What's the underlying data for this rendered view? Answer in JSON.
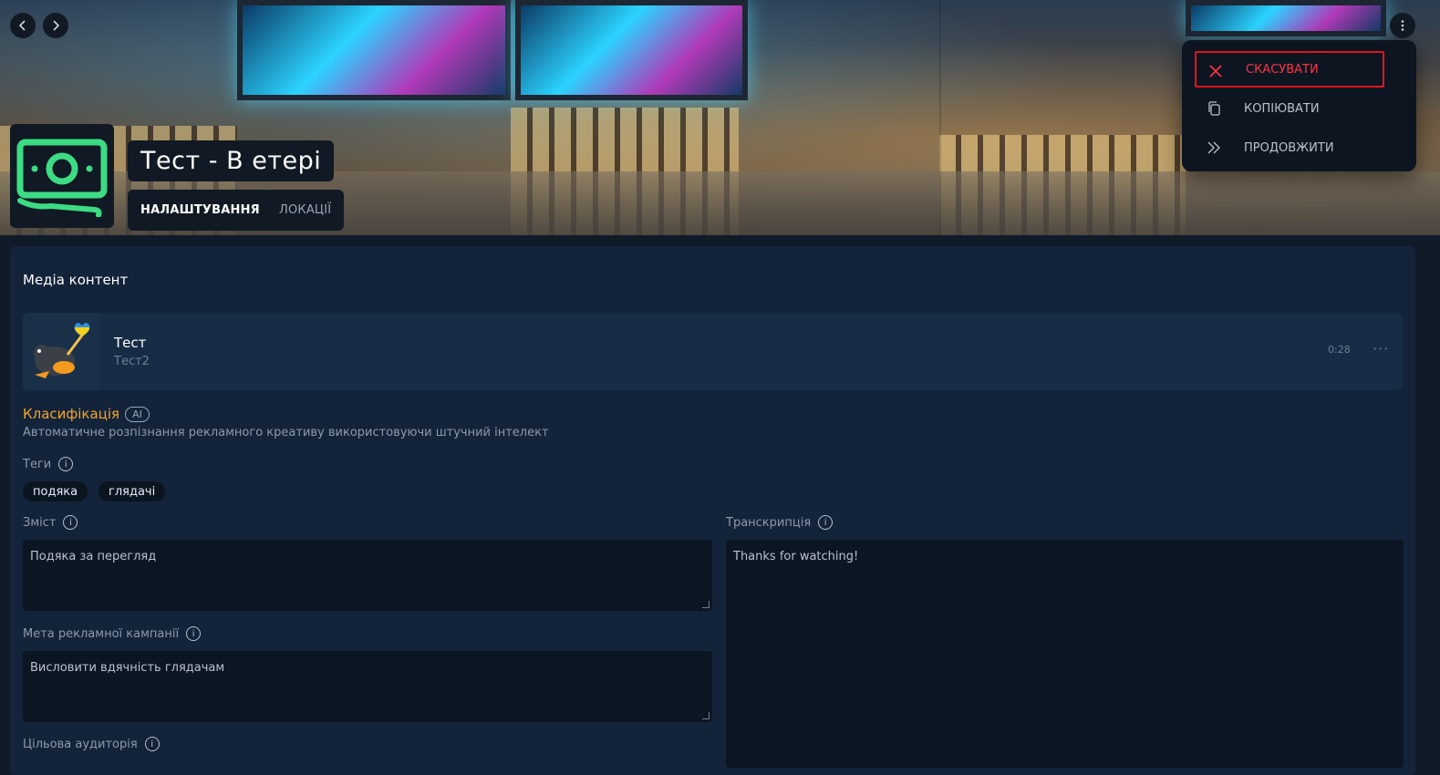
{
  "header": {
    "title": "Тест - В етері",
    "tabs": [
      {
        "label": "НАЛАШТУВАННЯ",
        "active": true
      },
      {
        "label": "ЛОКАЦІЇ",
        "active": false
      }
    ],
    "nav": {
      "back_icon": "chevron-left-icon",
      "forward_icon": "chevron-right-icon"
    },
    "logo_icon": "money-bill-icon",
    "more_icon": "vertical-dots-icon"
  },
  "menu": {
    "items": [
      {
        "label": "СКАСУВАТИ",
        "icon": "close-icon",
        "color": "#ff3347"
      },
      {
        "label": "КОПІЮВАТИ",
        "icon": "copy-icon"
      },
      {
        "label": "ПРОДОВЖИТИ",
        "icon": "double-chevron-right-icon"
      }
    ]
  },
  "main": {
    "section_title": "Медіа контент",
    "media": {
      "title": "Тест",
      "subtitle": "Тест2",
      "duration": "0:28",
      "more": "···"
    },
    "classification": {
      "title": "Класифікація",
      "badge": "AI",
      "description": "Автоматичне розпізнання рекламного креативу використовуючи штучний інтелект"
    },
    "tags_label": "Теги",
    "tags": [
      "подяка",
      "глядачі"
    ],
    "content_label": "Зміст",
    "content_value": "Подяка за перегляд",
    "transcription_label": "Транскрипція",
    "transcription_value": "Thanks for watching!",
    "goal_label": "Мета рекламної кампанії",
    "goal_value": "Висловити вдячність глядачам",
    "audience_label": "Цільова аудиторія"
  },
  "colors": {
    "accent_orange": "#f5a623",
    "danger": "#ff3347",
    "logo_green": "#3ddc84"
  }
}
